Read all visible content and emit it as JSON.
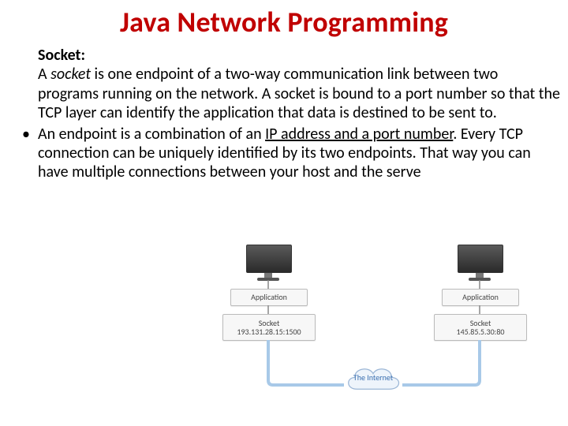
{
  "title": "Java Network Programming",
  "body": {
    "label": "Socket:",
    "para1_prefix": "A ",
    "para1_em": "socket",
    "para1_rest": " is one endpoint of a two-way communication link between two programs running on the network. A socket is bound to a port number so that the TCP layer can identify the application that data is destined to be sent to.",
    "bullet_prefix": "An endpoint is a combination of an ",
    "bullet_ul": "IP address and a port number",
    "bullet_rest": ". Every TCP connection can be uniquely identified by its two endpoints. That way you can have multiple connections between your host and the serve"
  },
  "figure": {
    "app_label": "Application",
    "socket_label": "Socket",
    "socket_left_ip": "193.131.28.15:1500",
    "socket_right_ip": "145.85.5.30:80",
    "cloud_label": "The Internet"
  }
}
